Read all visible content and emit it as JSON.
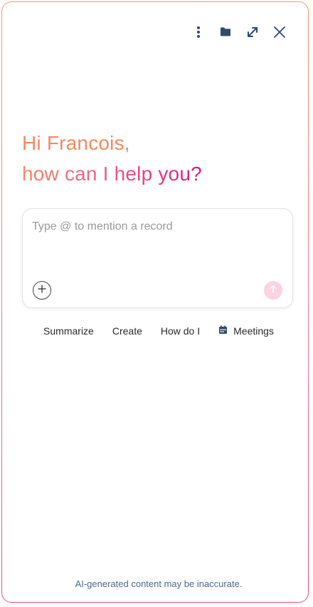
{
  "toolbar": {
    "icons": [
      "more-vertical-icon",
      "folder-icon",
      "expand-icon",
      "close-icon"
    ],
    "icon_color": "#2f4a6a"
  },
  "greeting": {
    "line1": "Hi Francois,",
    "line2": "how can I help you?"
  },
  "composer": {
    "value": "",
    "placeholder": "Type @ to mention a record",
    "add_icon": "plus-icon",
    "send_icon": "arrow-up-icon",
    "send_color": "#fbd3e2"
  },
  "suggestions": [
    {
      "label": "Summarize"
    },
    {
      "label": "Create"
    },
    {
      "label": "How do I"
    },
    {
      "label": "Meetings",
      "icon": "calendar-icon"
    }
  ],
  "footer": {
    "disclaimer": "AI-generated content may be inaccurate."
  },
  "colors": {
    "greeting_start": "#f5875f",
    "greeting_end": "#d81d7e",
    "border_gradient_top": "#f79a6b",
    "border_gradient_bottom": "#e8508e"
  }
}
